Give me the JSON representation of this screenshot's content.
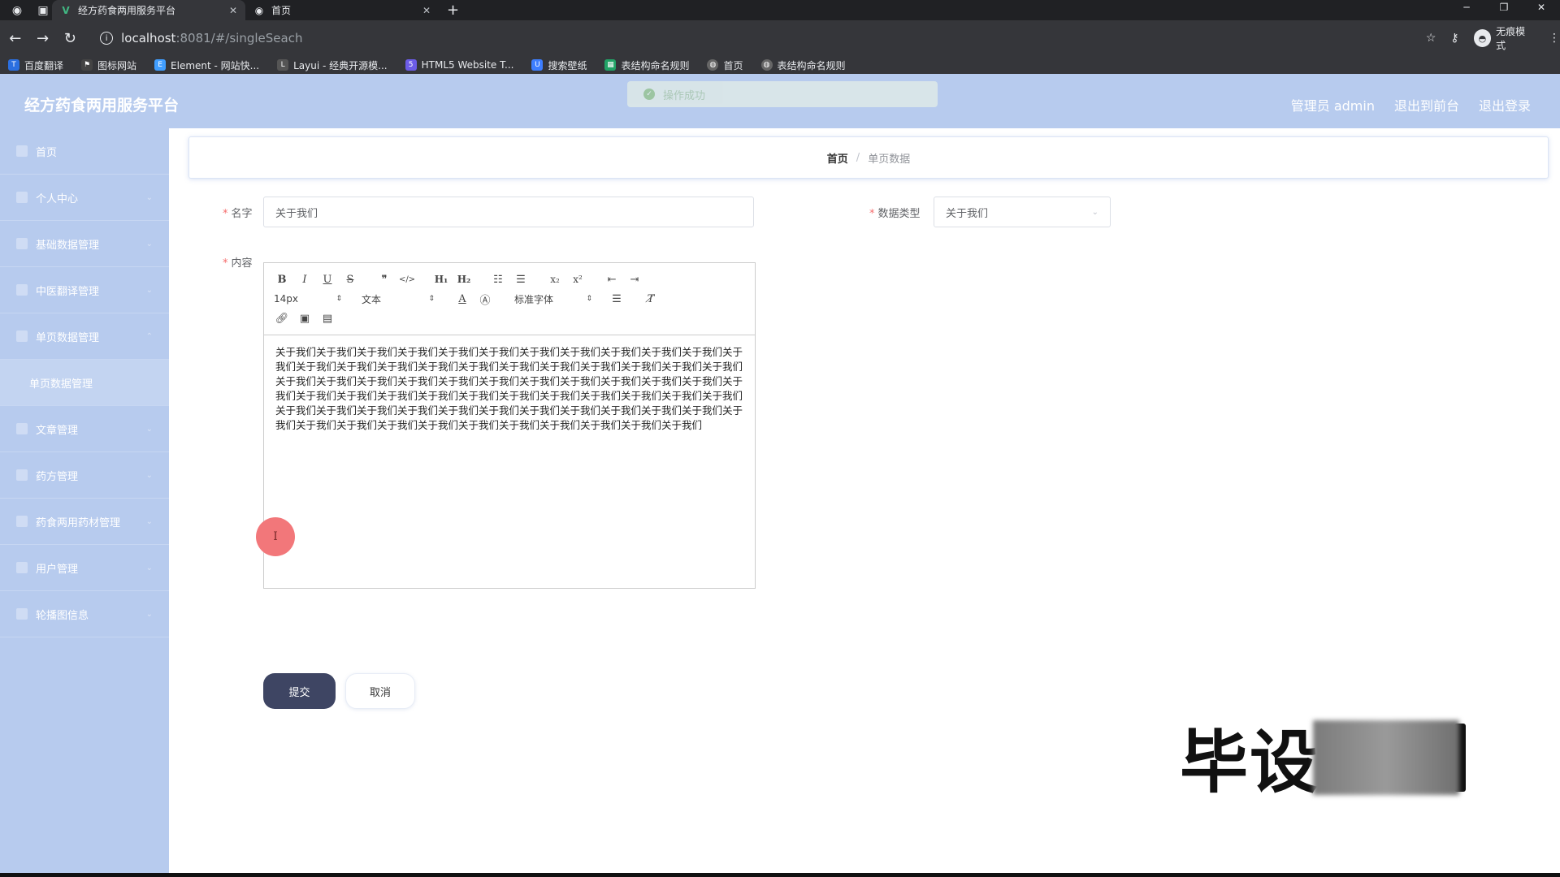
{
  "browser": {
    "tabs": [
      {
        "title": "经方药食两用服务平台",
        "active": true
      },
      {
        "title": "首页",
        "active": false
      }
    ],
    "url_host": "localhost",
    "url_path": ":8081/#/singleSeach",
    "incognito_label": "无痕模式",
    "bookmarks": [
      {
        "label": "百度翻译",
        "icon": "translate-icon",
        "color": "#2b6fe0"
      },
      {
        "label": "图标网站",
        "icon": "flag-icon",
        "color": "#444444"
      },
      {
        "label": "Element - 网站快...",
        "icon": "element-icon",
        "color": "#409eff"
      },
      {
        "label": "Layui - 经典开源模...",
        "icon": "layui-icon",
        "color": "#555555"
      },
      {
        "label": "HTML5 Website T...",
        "icon": "html5-icon",
        "color": "#6c5ce7"
      },
      {
        "label": "搜索壁纸",
        "icon": "wallpaper-icon",
        "color": "#3d7eff"
      },
      {
        "label": "表结构命名规则",
        "icon": "doc-icon",
        "color": "#21a366"
      },
      {
        "label": "首页",
        "icon": "globe-icon",
        "color": "#666666"
      },
      {
        "label": "表结构命名规则",
        "icon": "globe-icon",
        "color": "#666666"
      }
    ]
  },
  "app": {
    "title": "经方药食两用服务平台",
    "header_links": [
      "管理员 admin",
      "退出到前台",
      "退出登录"
    ],
    "toast": "操作成功",
    "sidebar": [
      {
        "label": "首页",
        "icon": "home-icon"
      },
      {
        "label": "个人中心",
        "icon": "user-icon"
      },
      {
        "label": "基础数据管理",
        "icon": "list-icon"
      },
      {
        "label": "中医翻译管理",
        "icon": "globe-icon"
      },
      {
        "label": "单页数据管理",
        "icon": "doc-icon"
      }
    ],
    "sidebar_sub": "单页数据管理",
    "sidebar_rest": [
      {
        "label": "文章管理",
        "icon": "article-icon"
      },
      {
        "label": "药方管理",
        "icon": "prescription-icon"
      },
      {
        "label": "药食两用药材管理",
        "icon": "herb-icon"
      },
      {
        "label": "用户管理",
        "icon": "users-icon"
      },
      {
        "label": "轮播图信息",
        "icon": "carousel-icon"
      }
    ],
    "breadcrumb": {
      "home": "首页",
      "separator": "/",
      "current": "单页数据"
    },
    "form": {
      "name_label": "名字",
      "name_value": "关于我们",
      "type_label": "数据类型",
      "type_value": "关于我们",
      "content_label": "内容",
      "editor": {
        "font_size": "14px",
        "header": "文本",
        "font_family": "标准字体",
        "content": "关于我们关于我们关于我们关于我们关于我们关于我们关于我们关于我们关于我们关于我们关于我们关于我们关于我们关于我们关于我们关于我们关于我们关于我们关于我们关于我们关于我们关于我们关于我们关于我们关于我们关于我们关于我们关于我们关于我们关于我们关于我们关于我们关于我们关于我们关于我们关于我们关于我们关于我们关于我们关于我们关于我们关于我们关于我们关于我们关于我们关于我们关于我们关于我们关于我们关于我们关于我们关于我们关于我们关于我们关于我们关于我们关于我们关于我们关于我们关于我们关于我们关于我们关于我们关于我们关于我们关于我们关于我们关于我们"
      },
      "submit": "提交",
      "cancel": "取消"
    },
    "watermark": "毕设"
  }
}
